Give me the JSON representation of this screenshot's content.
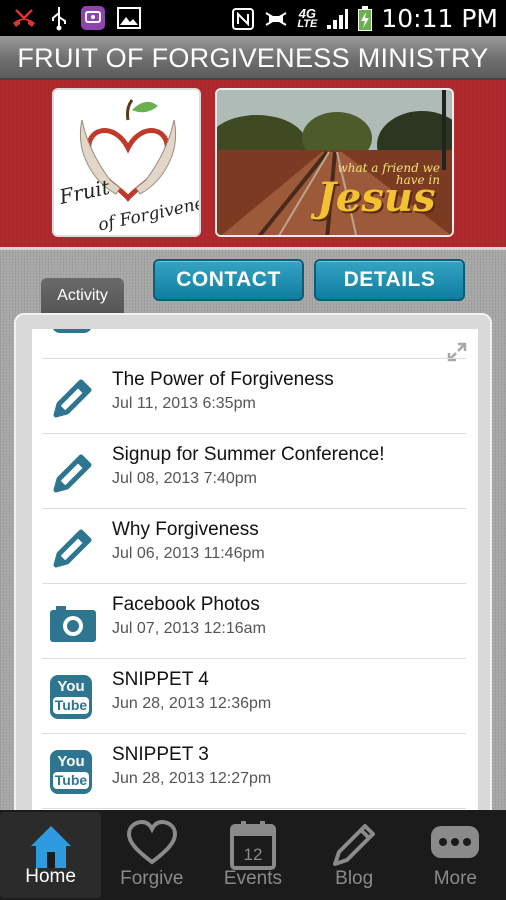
{
  "status_bar": {
    "time": "10:11 PM",
    "network": "4G",
    "network_sub": "LTE"
  },
  "title": "FRUIT OF FORGIVENESS MINISTRY",
  "banner": {
    "logo_text_line1": "Fruit",
    "logo_text_line2": "of Forgiveness",
    "photo_caption_small": "what a friend we have in",
    "photo_caption_large": "Jesus"
  },
  "actions": {
    "contact": "CONTACT",
    "details": "DETAILS"
  },
  "tabs": {
    "activity": "Activity"
  },
  "feed": [
    {
      "icon": "pencil-icon",
      "title": "The Power of Forgiveness",
      "date": "Jul 11, 2013 6:35pm"
    },
    {
      "icon": "pencil-icon",
      "title": "Signup for Summer Conference!",
      "date": "Jul 08, 2013 7:40pm"
    },
    {
      "icon": "pencil-icon",
      "title": "Why Forgiveness",
      "date": "Jul 06, 2013 11:46pm"
    },
    {
      "icon": "camera-icon",
      "title": "Facebook Photos",
      "date": "Jul 07, 2013 12:16am"
    },
    {
      "icon": "youtube-icon",
      "title": "SNIPPET 4",
      "date": "Jun 28, 2013 12:36pm"
    },
    {
      "icon": "youtube-icon",
      "title": "SNIPPET 3",
      "date": "Jun 28, 2013 12:27pm"
    }
  ],
  "youtube_icon_text": {
    "top": "You",
    "bottom": "Tube"
  },
  "nav": [
    {
      "label": "Home",
      "icon": "home-icon",
      "active": true
    },
    {
      "label": "Forgive",
      "icon": "heart-icon",
      "active": false
    },
    {
      "label": "Events",
      "icon": "calendar-icon",
      "active": false,
      "badge": "12"
    },
    {
      "label": "Blog",
      "icon": "pen-icon",
      "active": false
    },
    {
      "label": "More",
      "icon": "more-icon",
      "active": false
    }
  ],
  "colors": {
    "accent": "#1a89ad",
    "banner": "#b22a2e",
    "icon": "#2e7590"
  }
}
